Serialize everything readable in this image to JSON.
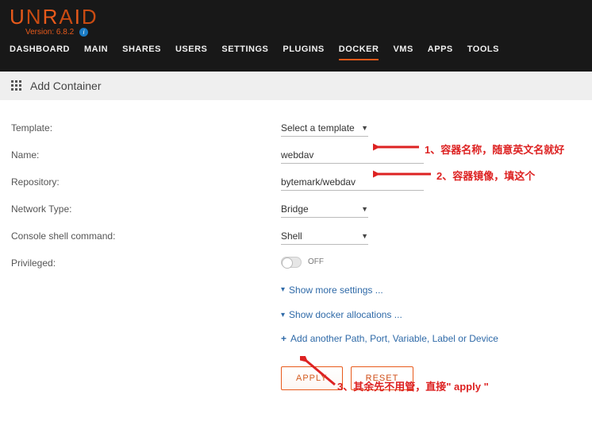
{
  "brand": {
    "segments": [
      "U",
      "N",
      "R",
      "A",
      "I",
      "D"
    ]
  },
  "version": {
    "prefix": "Version: ",
    "value": "6.8.2"
  },
  "nav": {
    "items": [
      "DASHBOARD",
      "MAIN",
      "SHARES",
      "USERS",
      "SETTINGS",
      "PLUGINS",
      "DOCKER",
      "VMS",
      "APPS",
      "TOOLS"
    ],
    "active_index": 6
  },
  "page_header": "Add Container",
  "form": {
    "template": {
      "label": "Template:",
      "value": "Select a template"
    },
    "name": {
      "label": "Name:",
      "value": "webdav"
    },
    "repository": {
      "label": "Repository:",
      "value": "bytemark/webdav"
    },
    "network": {
      "label": "Network Type:",
      "value": "Bridge"
    },
    "console": {
      "label": "Console shell command:",
      "value": "Shell"
    },
    "privileged": {
      "label": "Privileged:",
      "state": "OFF"
    }
  },
  "links": {
    "show_more": "Show more settings ...",
    "show_docker": "Show docker allocations ...",
    "add_path": "Add another Path, Port, Variable, Label or Device"
  },
  "buttons": {
    "apply": "APPLY",
    "reset": "RESET"
  },
  "annotations": {
    "a1": "1、容器名称，随意英文名就好",
    "a2": "2、容器镜像，填这个",
    "a3": "3、其余先不用管，直接\" apply \""
  }
}
